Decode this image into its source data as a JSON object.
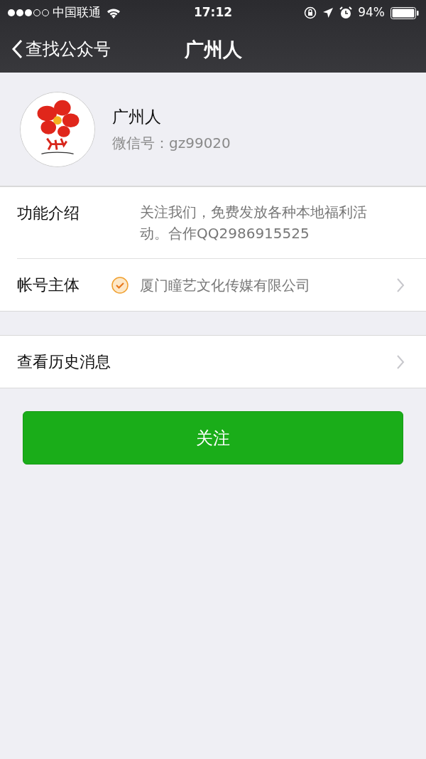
{
  "status_bar": {
    "carrier": "中国联通",
    "time": "17:12",
    "battery_text": "94%"
  },
  "nav_bar": {
    "back_label": "查找公众号",
    "title": "广州人"
  },
  "profile": {
    "name": "广州人",
    "wechat_id": "微信号：gz99020"
  },
  "info_rows": [
    {
      "label": "功能介绍",
      "value": "关注我们，免费发放各种本地福利活动。合作QQ2986915525",
      "verified": false,
      "chevron": false
    },
    {
      "label": "帐号主体",
      "value": "厦门瞳艺文化传媒有限公司",
      "verified": true,
      "chevron": true
    }
  ],
  "history_row": {
    "label": "查看历史消息"
  },
  "follow_button": {
    "label": "关注"
  }
}
